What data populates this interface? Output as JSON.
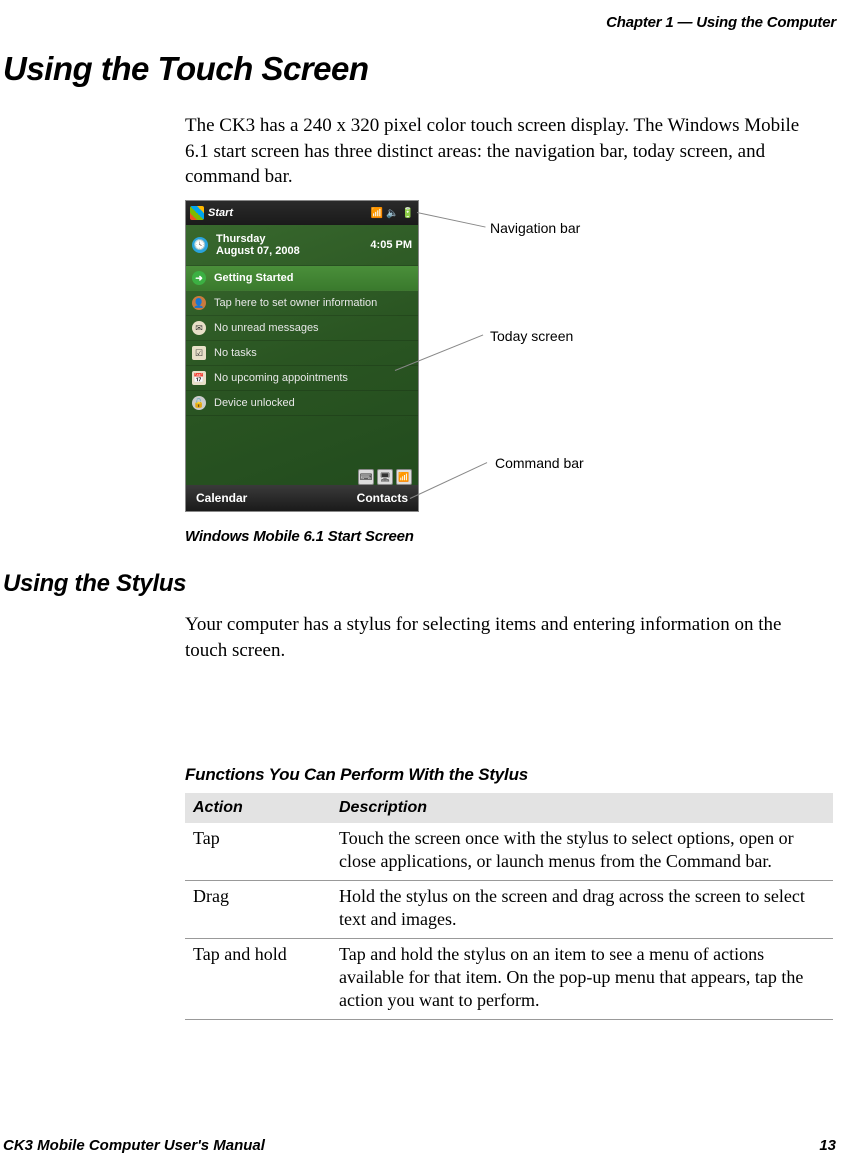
{
  "header": {
    "chapter": "Chapter 1 — Using the Computer"
  },
  "section1": {
    "title": "Using the Touch Screen",
    "para": "The CK3 has a 240 x 320 pixel color touch screen display. The Windows Mobile 6.1 start screen has three distinct areas: the navigation bar, today screen, and command bar."
  },
  "screenshot": {
    "start": "Start",
    "day": "Thursday",
    "date": "August 07, 2008",
    "time": "4:05 PM",
    "rows": {
      "getting_started": "Getting Started",
      "owner": "Tap here to set owner information",
      "messages": "No unread messages",
      "tasks": "No tasks",
      "appts": "No upcoming appointments",
      "lock": "Device unlocked"
    },
    "cmd_left": "Calendar",
    "cmd_right": "Contacts",
    "callouts": {
      "nav": "Navigation bar",
      "today": "Today screen",
      "cmd": "Command bar"
    },
    "caption": "Windows Mobile 6.1 Start Screen"
  },
  "section2": {
    "title": "Using the Stylus",
    "para": "Your computer has a stylus for selecting items and entering information on the touch screen."
  },
  "table": {
    "caption": "Functions You Can Perform With the Stylus",
    "head_action": "Action",
    "head_desc": "Description",
    "rows": [
      {
        "action": "Tap",
        "desc": "Touch the screen once with the stylus to select options, open or close applications, or launch menus from the Command bar."
      },
      {
        "action": "Drag",
        "desc": "Hold the stylus on the screen and drag across the screen to select text and images."
      },
      {
        "action": "Tap and hold",
        "desc": "Tap and hold the stylus on an item to see a menu of actions available for that item. On the pop-up menu that appears, tap the action you want to perform."
      }
    ]
  },
  "footer": {
    "manual": "CK3 Mobile Computer User's Manual",
    "page": "13"
  }
}
